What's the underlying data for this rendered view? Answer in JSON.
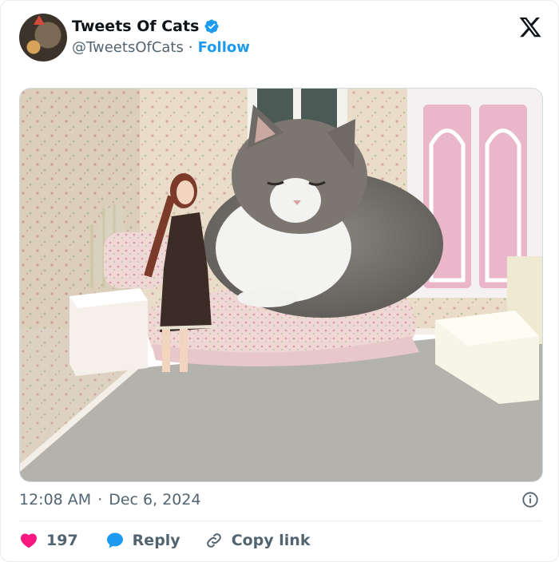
{
  "author": {
    "name": "Tweets Of Cats",
    "handle": "@TweetsOfCats",
    "separator": "·",
    "follow_label": "Follow"
  },
  "post": {
    "time": "12:08 AM",
    "separator": "·",
    "date": "Dec 6, 2024",
    "image_alt": "Large gray and white cat lying on a doll bed beside a doll in a dollhouse room"
  },
  "actions": {
    "like_count": "197",
    "reply_label": "Reply",
    "copy_label": "Copy link"
  },
  "colors": {
    "accent": "#1d9bf0",
    "like": "#f91880",
    "text_secondary": "#536471"
  },
  "icons": [
    "verified-badge-icon",
    "x-logo-icon",
    "info-icon",
    "heart-icon",
    "reply-bubble-icon",
    "link-icon"
  ]
}
